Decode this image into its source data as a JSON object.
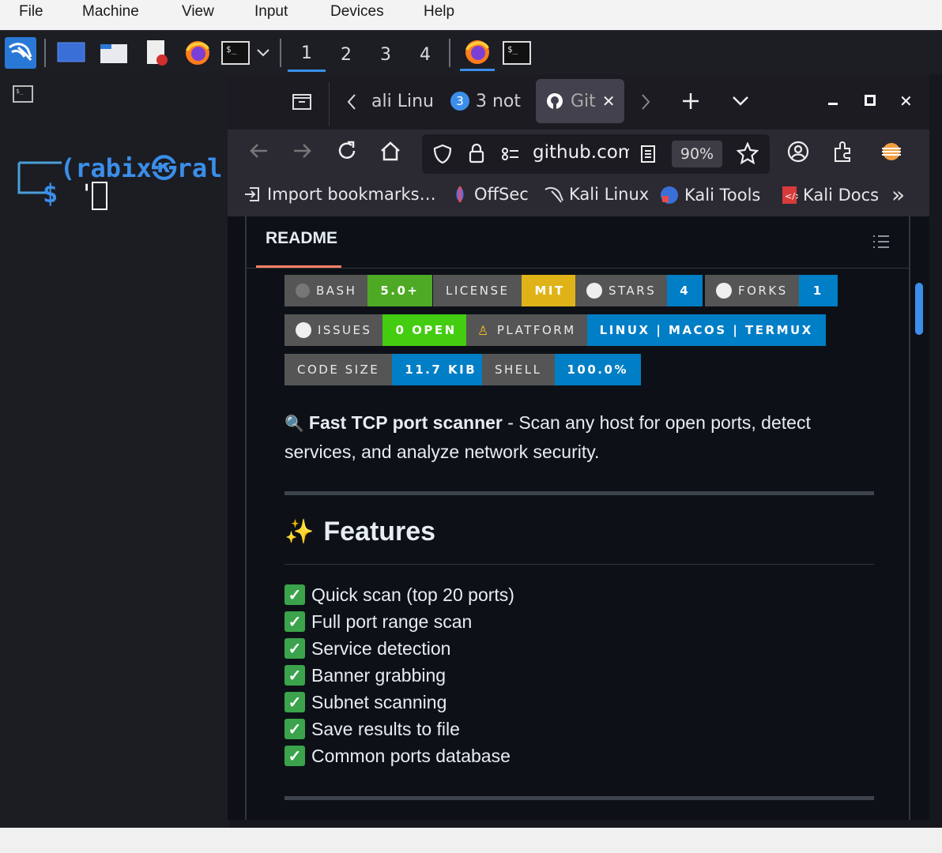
{
  "vm_menu": [
    "File",
    "Machine",
    "View",
    "Input",
    "Devices",
    "Help"
  ],
  "panel": {
    "workspaces": [
      "1",
      "2",
      "3",
      "4"
    ],
    "active_workspace": "1"
  },
  "terminal": {
    "prompt_user": "(rabix㉿ral",
    "prompt_symbol": "$",
    "input": "'"
  },
  "firefox": {
    "tabs": [
      {
        "label": "ali Linu",
        "active": false
      },
      {
        "label": "3 not",
        "badge": "3",
        "active": false
      },
      {
        "label": "Git",
        "active": true
      }
    ],
    "url": "github.com",
    "zoom": "90%",
    "bookmarks": [
      "Import bookmarks…",
      "OffSec",
      "Kali Linux",
      "Kali Tools",
      "Kali Docs"
    ],
    "bookmarks_more": "»"
  },
  "readme": {
    "title": "README",
    "badges": [
      {
        "label": "BASH",
        "value": "5.0+",
        "color": "#4eaa25"
      },
      {
        "label": "LICENSE",
        "value": "MIT",
        "color": "#dfb317"
      },
      {
        "label": "STARS",
        "value": "4",
        "color": "#007ec6"
      },
      {
        "label": "FORKS",
        "value": "1",
        "color": "#007ec6"
      },
      {
        "label": "ISSUES",
        "value": "0 OPEN",
        "color": "#44cc11"
      },
      {
        "label": "PLATFORM",
        "value": "LINUX | MACOS | TERMUX",
        "color": "#007ec6"
      },
      {
        "label": "CODE SIZE",
        "value": "11.7 KIB",
        "color": "#007ec6"
      },
      {
        "label": "SHELL",
        "value": "100.0%",
        "color": "#007ec6"
      }
    ],
    "desc_bold": "Fast TCP port scanner",
    "desc_rest": " - Scan any host for open ports, detect services, and analyze network security.",
    "features_title": "Features",
    "features": [
      "Quick scan (top 20 ports)",
      "Full port range scan",
      "Service detection",
      "Banner grabbing",
      "Subnet scanning",
      "Save results to file",
      "Common ports database"
    ]
  }
}
